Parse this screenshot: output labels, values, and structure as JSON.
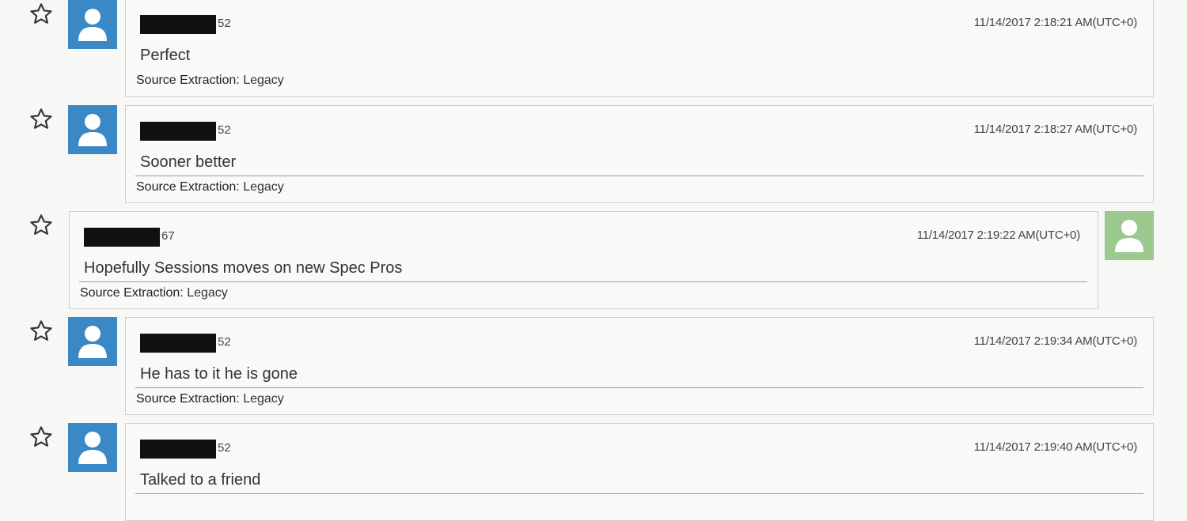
{
  "messages": [
    {
      "sender_suffix": "52",
      "timestamp": "11/14/2017 2:18:21 AM(UTC+0)",
      "text": "Perfect",
      "source_label": "Source Extraction:",
      "source_value": "Legacy",
      "side": "left",
      "avatar_color": "#3a88c5"
    },
    {
      "sender_suffix": "52",
      "timestamp": "11/14/2017 2:18:27 AM(UTC+0)",
      "text": "Sooner better",
      "source_label": "Source Extraction:",
      "source_value": "Legacy",
      "side": "left",
      "avatar_color": "#3a88c5"
    },
    {
      "sender_suffix": "67",
      "timestamp": "11/14/2017 2:19:22 AM(UTC+0)",
      "text": "Hopefully Sessions moves on new Spec Pros",
      "source_label": "Source Extraction:",
      "source_value": "Legacy",
      "side": "right",
      "avatar_color": "#9cc98e"
    },
    {
      "sender_suffix": "52",
      "timestamp": "11/14/2017 2:19:34 AM(UTC+0)",
      "text": "He has to it he is gone",
      "source_label": "Source Extraction:",
      "source_value": "Legacy",
      "side": "left",
      "avatar_color": "#3a88c5"
    },
    {
      "sender_suffix": "52",
      "timestamp": "11/14/2017 2:19:40 AM(UTC+0)",
      "text": "Talked to a friend",
      "side": "left",
      "avatar_color": "#3a88c5"
    }
  ],
  "icons": {
    "star": "star-outline-icon",
    "avatar": "user-avatar-icon",
    "redaction": "redacted-name-block"
  }
}
